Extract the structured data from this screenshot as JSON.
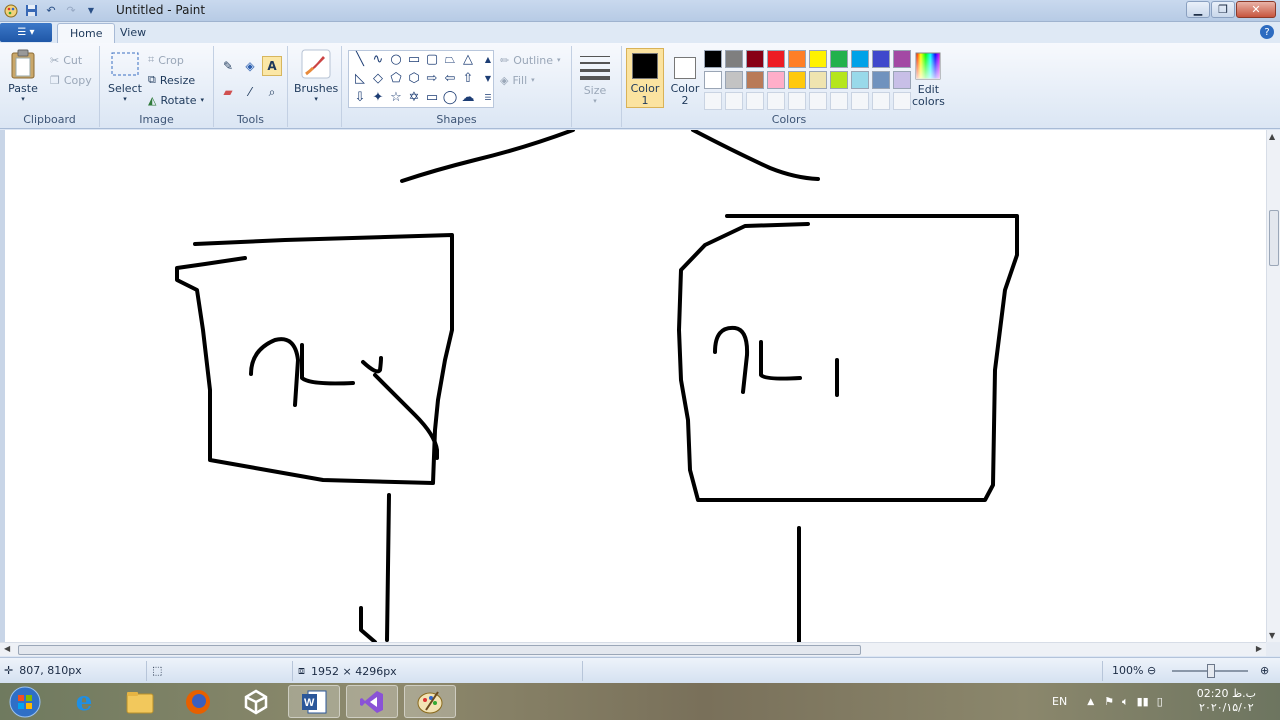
{
  "window": {
    "title": "Untitled - Paint",
    "qat_icons": [
      "paint-app-icon",
      "save-icon",
      "undo-icon",
      "redo-icon",
      "customize-qat-icon"
    ]
  },
  "tabs": [
    {
      "label": "Home",
      "active": true
    },
    {
      "label": "View",
      "active": false
    }
  ],
  "ribbon": {
    "clipboard": {
      "paste": "Paste",
      "cut": "Cut",
      "copy": "Copy",
      "group": "Clipboard"
    },
    "image": {
      "select": "Select",
      "crop": "Crop",
      "resize": "Resize",
      "rotate": "Rotate",
      "group": "Image"
    },
    "tools": {
      "group": "Tools"
    },
    "brushes": {
      "label": "Brushes"
    },
    "shapes": {
      "outline": "Outline",
      "fill": "Fill",
      "group": "Shapes"
    },
    "size": {
      "label": "Size"
    },
    "colors": {
      "color1_label": "Color\n1",
      "color2_label": "Color\n2",
      "color1": "#000000",
      "color2": "#ffffff",
      "edit_label": "Edit\ncolors",
      "group": "Colors",
      "palette_row1": [
        "#000000",
        "#7f7f7f",
        "#880015",
        "#ed1c24",
        "#ff7f27",
        "#fff200",
        "#22b14c",
        "#00a2e8",
        "#3f48cc",
        "#a349a4"
      ],
      "palette_row2": [
        "#ffffff",
        "#c3c3c3",
        "#b97a57",
        "#ffaec9",
        "#ffc90e",
        "#efe4b0",
        "#b5e61d",
        "#99d9ea",
        "#7092be",
        "#c8bfe7"
      ]
    }
  },
  "status": {
    "cursor_pos": "807, 810px",
    "image_size": "1952 × 4296px",
    "zoom": "100%",
    "zoom_level": 1.0
  },
  "taskbar": {
    "apps": [
      "start-orb-icon",
      "internet-explorer-icon",
      "file-explorer-icon",
      "firefox-icon",
      "unity-icon",
      "word-icon",
      "visual-studio-icon",
      "paint-icon"
    ],
    "language": "EN",
    "time": "02:20 ب.ظ",
    "date": "۲۰۲۰/۱۵/۰۲"
  }
}
